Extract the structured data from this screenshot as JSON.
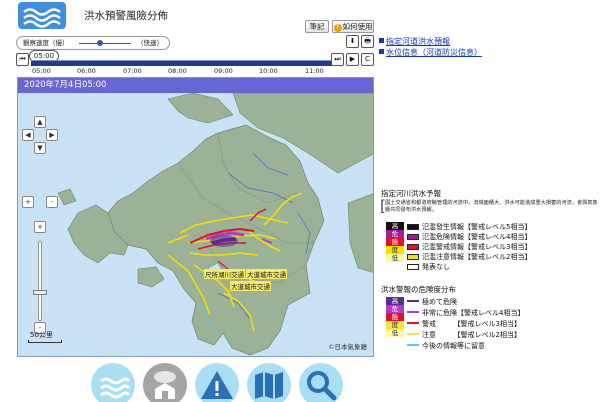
{
  "header": {
    "title": "洪水預警風險分佈",
    "memo_label": "筆記",
    "help_label": "如何使用",
    "help_glyph": "?"
  },
  "speed": {
    "slow_label": "觀察速度（慢）",
    "fast_label": "（快速）",
    "level_percent": 40
  },
  "toolbar": {
    "download_glyph": "⬇",
    "print_glyph": "🖶",
    "prev_glyph": "⏮",
    "play_glyph": "▶",
    "next_glyph": "⏭",
    "refresh_glyph": "C"
  },
  "timeline": {
    "current": "05:00",
    "ticks": [
      "05:00",
      "06:00",
      "07:00",
      "08:00",
      "09:00",
      "10:00",
      "11:00"
    ]
  },
  "map": {
    "datetime": "2020年7月4日05:00",
    "zoom_in": "+",
    "zoom_out": "-",
    "scale": "50公里",
    "attribution": "©日本氣象廳",
    "labels": [
      "尺所湖川交通",
      "大道城市交通",
      "大道城市交通"
    ],
    "nav": {
      "up": "▲",
      "left": "◀",
      "right": "▶",
      "down": "▼",
      "pan_in": "+",
      "pan_out": "-"
    }
  },
  "links": {
    "flood_forecast": "指定河道洪水預報",
    "water_level": "水位信息（河道防災信息）"
  },
  "legend_rivers": {
    "title": "指定河川洪水予報",
    "note": "國土交通省和都道府縣管理的河流中，流域面積大、洪水可能造成重大損害的河流，會與氣象廳共同發布洪水預報。",
    "scale": [
      "高",
      "危",
      "險",
      "度",
      "低"
    ],
    "items": [
      {
        "label": "氾濫發生情報【警戒レベル5相当】",
        "color": "#111111"
      },
      {
        "label": "氾濫危険情報【警戒レベル4相当】",
        "color": "#a5199b"
      },
      {
        "label": "氾濫警戒情報【警戒レベル3相当】",
        "color": "#e7102b"
      },
      {
        "label": "氾濫注意情報【警戒レベル2相当】",
        "color": "#f2e500"
      },
      {
        "label": "発表なし",
        "color": "#ffffff"
      }
    ]
  },
  "legend_risk": {
    "title": "洪水警報の危険度分布",
    "scale": [
      "高",
      "危",
      "險",
      "度",
      "低"
    ],
    "items": [
      {
        "label": "極めて危険",
        "color": "#5c2a8e"
      },
      {
        "label": "非常に危険【警戒レベル4相当】",
        "color": "#b33cc9"
      },
      {
        "label": "警戒　　　【警戒レベル3相当】",
        "color": "#e7102b"
      },
      {
        "label": "注意　　　【警戒レベル2相当】",
        "color": "#f7e43a"
      },
      {
        "label": "今後の情報等に留意",
        "color": "#4fd0f0"
      }
    ]
  },
  "colors": {
    "accent": "#3f8ee0",
    "date_bar": "#6766d4",
    "timeline": "#1e3f86",
    "link": "#1538b3",
    "sea": "#c9e2f6",
    "land": "#9bb296"
  },
  "bottom_nav": [
    {
      "icon": "flood-waves-icon",
      "color": "#a9dff3"
    },
    {
      "icon": "rain-gauge-icon",
      "color": "#a5a5a5"
    },
    {
      "icon": "warning-triangle-icon",
      "color": "#a9dff3"
    },
    {
      "icon": "map-icon",
      "color": "#a9dff3"
    },
    {
      "icon": "search-icon",
      "color": "#a9dff3"
    }
  ]
}
